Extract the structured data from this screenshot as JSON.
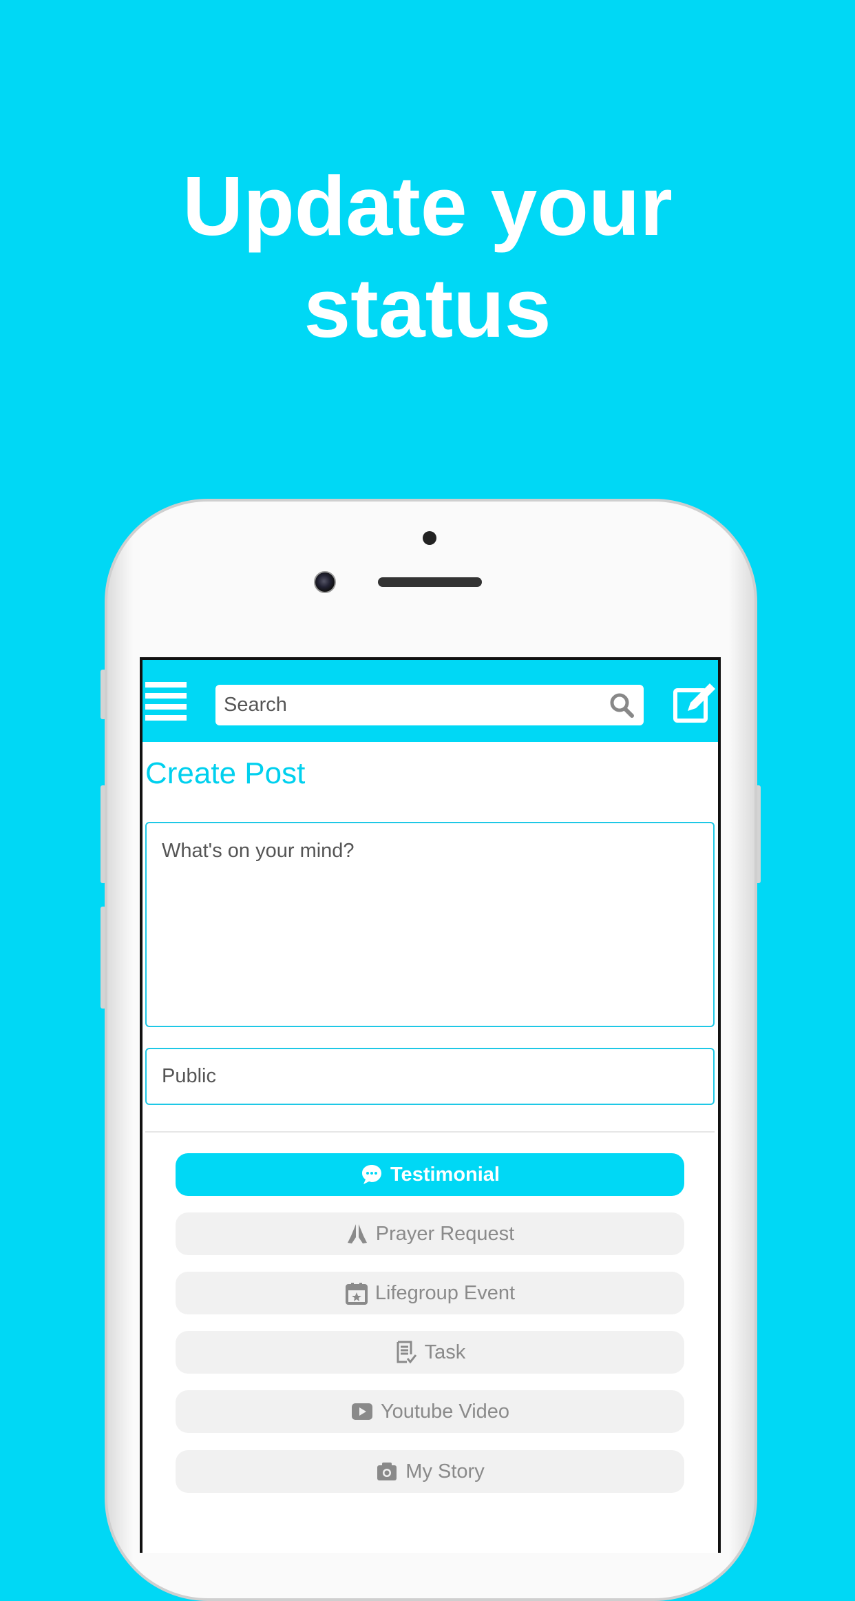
{
  "headline": {
    "line1": "Update your",
    "line2": "status"
  },
  "colors": {
    "background": "#00d8f5",
    "accent": "#00d8f5",
    "button_inactive": "#f1f1f1"
  },
  "app": {
    "search": {
      "placeholder": "Search",
      "icon": "search-icon"
    },
    "menu_icon": "hamburger-icon",
    "compose_icon": "edit-icon",
    "page_title": "Create Post",
    "post_field": {
      "placeholder": "What's on your mind?"
    },
    "privacy": {
      "value": "Public"
    },
    "post_types": [
      {
        "label": "Testimonial",
        "icon": "chat-bubble-icon",
        "active": true
      },
      {
        "label": "Prayer Request",
        "icon": "praying-hands-icon",
        "active": false
      },
      {
        "label": "Lifegroup Event",
        "icon": "calendar-icon",
        "active": false
      },
      {
        "label": "Task",
        "icon": "task-list-icon",
        "active": false
      },
      {
        "label": "Youtube Video",
        "icon": "youtube-icon",
        "active": false
      },
      {
        "label": "My Story",
        "icon": "camera-icon",
        "active": false
      }
    ]
  }
}
